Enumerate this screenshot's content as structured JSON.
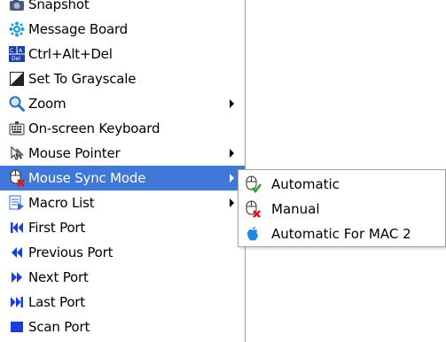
{
  "menu": {
    "items": [
      {
        "label": "Snapshot",
        "icon": "camera-icon"
      },
      {
        "label": "Message Board",
        "icon": "message-board-icon"
      },
      {
        "label": "Ctrl+Alt+Del",
        "icon": "ctrl-alt-del-icon"
      },
      {
        "label": "Set To Grayscale",
        "icon": "grayscale-icon"
      },
      {
        "label": "Zoom",
        "icon": "zoom-icon",
        "submenu": true
      },
      {
        "label": "On-screen Keyboard",
        "icon": "keyboard-icon"
      },
      {
        "label": "Mouse Pointer",
        "icon": "mouse-pointer-icon",
        "submenu": true
      },
      {
        "label": "Mouse Sync Mode",
        "icon": "mouse-sync-icon",
        "submenu": true,
        "active": true
      },
      {
        "label": "Macro List",
        "icon": "macro-list-icon",
        "submenu": true
      },
      {
        "label": "First Port",
        "icon": "first-port-icon"
      },
      {
        "label": "Previous Port",
        "icon": "previous-port-icon"
      },
      {
        "label": "Next Port",
        "icon": "next-port-icon"
      },
      {
        "label": "Last Port",
        "icon": "last-port-icon"
      },
      {
        "label": "Scan Port",
        "icon": "scan-port-icon"
      }
    ]
  },
  "submenu": {
    "items": [
      {
        "label": "Automatic",
        "icon": "automatic-mouse-icon"
      },
      {
        "label": "Manual",
        "icon": "manual-mouse-icon"
      },
      {
        "label": "Automatic For MAC 2",
        "icon": "apple-icon"
      }
    ]
  },
  "colors": {
    "highlight": "#3f78d6",
    "port_arrows": "#1a3fd6"
  }
}
